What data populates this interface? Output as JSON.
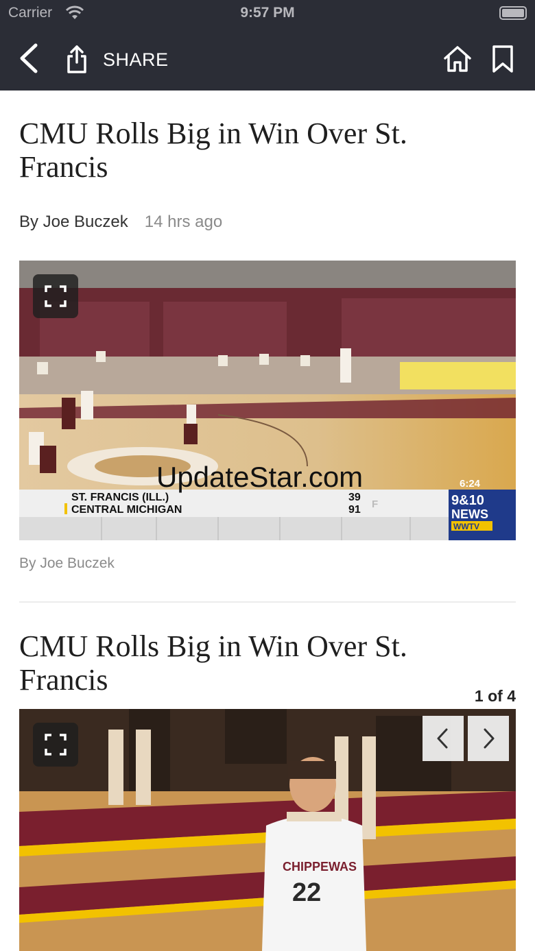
{
  "status_bar": {
    "carrier": "Carrier",
    "time": "9:57 PM"
  },
  "nav": {
    "share_label": "SHARE"
  },
  "article": {
    "headline": "CMU Rolls Big in Win Over St. Francis",
    "author": "By Joe Buczek",
    "time_ago": "14 hrs ago",
    "video_caption": "By Joe Buczek",
    "watermark": "UpdateStar.com",
    "scoreboard": {
      "team1": "ST. FRANCIS (ILL.)",
      "team2": "CENTRAL MICHIGAN",
      "score1": "39",
      "score2": "91",
      "period": "F",
      "clock": "6:24",
      "station_line1": "9&10",
      "station_line2": "NEWS",
      "station_line3": "WWTV"
    },
    "jersey": {
      "name": "CHIPPEWAS",
      "number": "22"
    }
  },
  "gallery": {
    "headline": "CMU Rolls Big in Win Over St. Francis",
    "counter": "1 of 4"
  },
  "colors": {
    "nav_bg": "#2b2d36",
    "maroon": "#6a1c2a",
    "gold": "#f2c200"
  },
  "icons": [
    "wifi-icon",
    "battery-icon",
    "back-icon",
    "share-icon",
    "home-icon",
    "bookmark-icon",
    "fullscreen-icon",
    "chevron-left-icon",
    "chevron-right-icon"
  ]
}
